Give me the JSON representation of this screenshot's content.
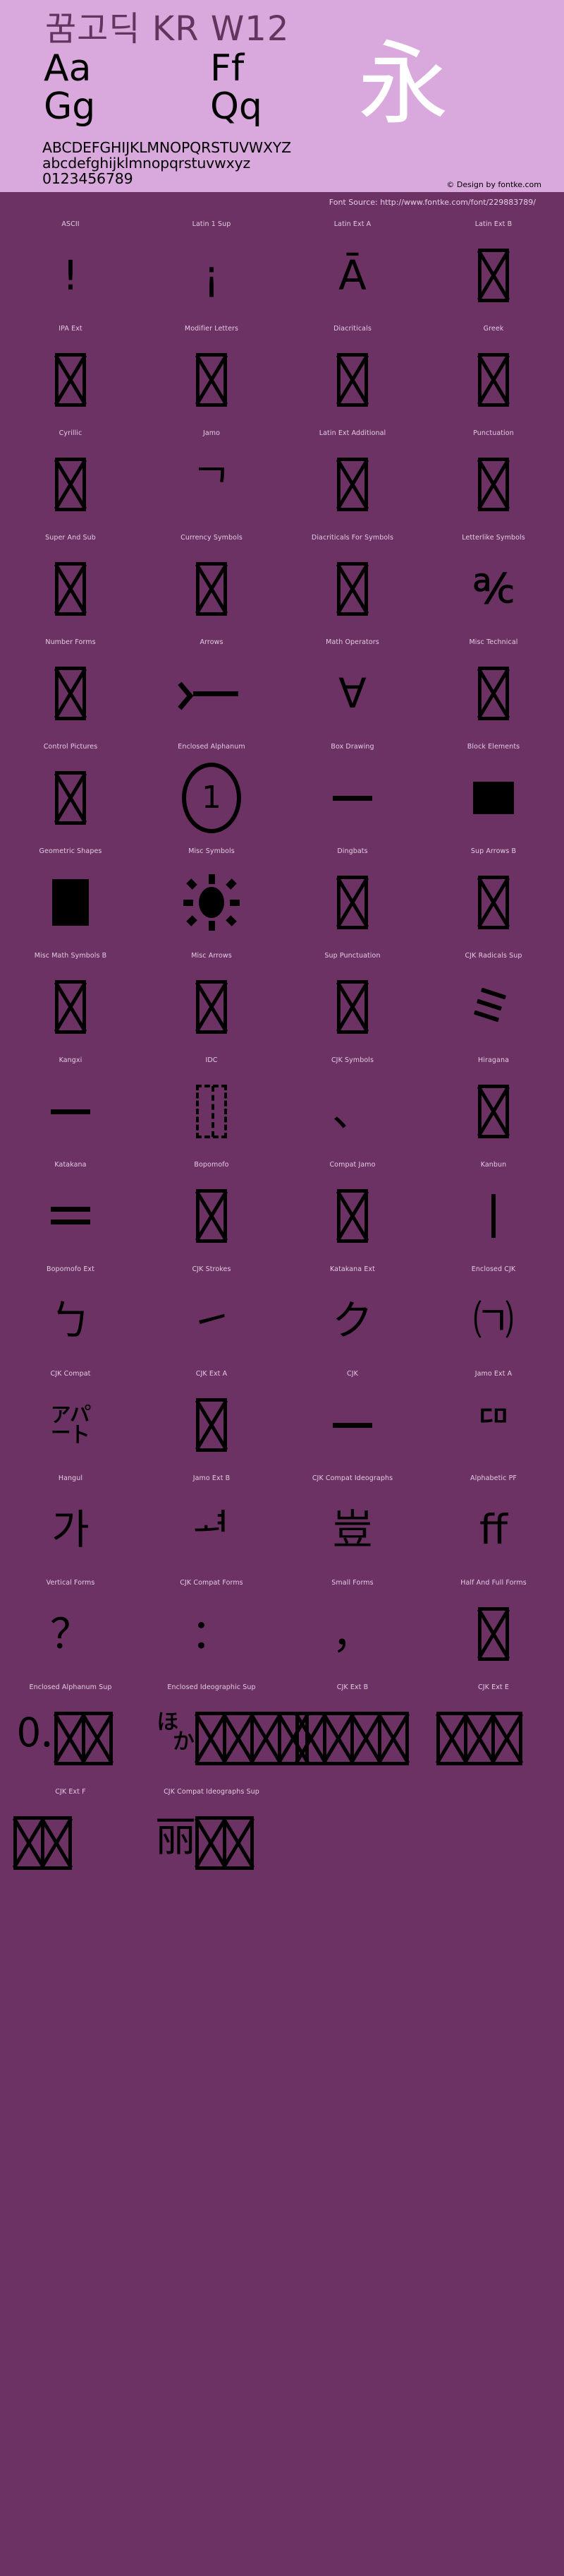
{
  "header": {
    "title": "꿈고딕 KR W12",
    "specimen_rows": [
      {
        "col1": "Aa",
        "col2": "Ff"
      },
      {
        "col1": "Gg",
        "col2": "Qq"
      }
    ],
    "cjk_specimen": "永",
    "alphabet_uppercase": "ABCDEFGHIJKLMNOPQRSTUVWXYZ",
    "alphabet_lowercase": "abcdefghijklmnopqrstuvwxyz",
    "digits": "0123456789",
    "credit": "© Design by fontke.com",
    "bg_color": "#d9a8dc",
    "title_color": "#63345e"
  },
  "source": {
    "label": "Font Source: http://www.fontke.com/font/229883789/",
    "bg_color": "#6b3263"
  },
  "grid": {
    "columns": 4,
    "label_color": "#e3cbe1",
    "glyph_color": "#000000",
    "cells": [
      {
        "label": "ASCII",
        "glyph": "!",
        "kind": "text",
        "size": "normal"
      },
      {
        "label": "Latin 1 Sup",
        "glyph": "¡",
        "kind": "text",
        "size": "normal"
      },
      {
        "label": "Latin Ext A",
        "glyph": "Ā",
        "kind": "text",
        "size": "normal"
      },
      {
        "label": "Latin Ext B",
        "glyph": "",
        "kind": "tofu",
        "size": "normal"
      },
      {
        "label": "IPA Ext",
        "glyph": "",
        "kind": "tofu",
        "size": "normal"
      },
      {
        "label": "Modifier Letters",
        "glyph": "",
        "kind": "tofu",
        "size": "normal"
      },
      {
        "label": "Diacriticals",
        "glyph": "",
        "kind": "tofu",
        "size": "normal"
      },
      {
        "label": "Greek",
        "glyph": "",
        "kind": "tofu",
        "size": "normal"
      },
      {
        "label": "Cyrillic",
        "glyph": "",
        "kind": "tofu",
        "size": "normal"
      },
      {
        "label": "Jamo",
        "glyph": "ᄀ",
        "kind": "text",
        "size": "normal"
      },
      {
        "label": "Latin Ext Additional",
        "glyph": "",
        "kind": "tofu",
        "size": "normal"
      },
      {
        "label": "Punctuation",
        "glyph": "",
        "kind": "tofu",
        "size": "normal"
      },
      {
        "label": "Super And Sub",
        "glyph": "",
        "kind": "tofu",
        "size": "normal"
      },
      {
        "label": "Currency Symbols",
        "glyph": "",
        "kind": "tofu",
        "size": "normal"
      },
      {
        "label": "Diacriticals For Symbols",
        "glyph": "",
        "kind": "tofu",
        "size": "normal"
      },
      {
        "label": "Letterlike Symbols",
        "glyph": "℀",
        "kind": "text",
        "size": "normal"
      },
      {
        "label": "Number Forms",
        "glyph": "",
        "kind": "tofu",
        "size": "normal"
      },
      {
        "label": "Arrows",
        "glyph": "←",
        "kind": "arrow",
        "size": "normal"
      },
      {
        "label": "Math Operators",
        "glyph": "∀",
        "kind": "text",
        "size": "normal"
      },
      {
        "label": "Misc Technical",
        "glyph": "",
        "kind": "tofu",
        "size": "normal"
      },
      {
        "label": "Control Pictures",
        "glyph": "",
        "kind": "tofu",
        "size": "normal"
      },
      {
        "label": "Enclosed Alphanum",
        "glyph": "1",
        "kind": "circled",
        "size": "normal"
      },
      {
        "label": "Box Drawing",
        "glyph": "─",
        "kind": "hline",
        "size": "normal"
      },
      {
        "label": "Block Elements",
        "glyph": "█",
        "kind": "block",
        "size": "normal"
      },
      {
        "label": "Geometric Shapes",
        "glyph": "■",
        "kind": "block-sq",
        "size": "normal"
      },
      {
        "label": "Misc Symbols",
        "glyph": "☀",
        "kind": "sun",
        "size": "normal"
      },
      {
        "label": "Dingbats",
        "glyph": "",
        "kind": "tofu",
        "size": "normal"
      },
      {
        "label": "Sup Arrows B",
        "glyph": "",
        "kind": "tofu",
        "size": "normal"
      },
      {
        "label": "Misc Math Symbols B",
        "glyph": "",
        "kind": "tofu",
        "size": "normal"
      },
      {
        "label": "Misc Arrows",
        "glyph": "",
        "kind": "tofu",
        "size": "normal"
      },
      {
        "label": "Sup Punctuation",
        "glyph": "",
        "kind": "tofu",
        "size": "normal"
      },
      {
        "label": "CJK Radicals Sup",
        "glyph": "⺀",
        "kind": "strokes3",
        "size": "normal"
      },
      {
        "label": "Kangxi",
        "glyph": "⼀",
        "kind": "hline",
        "size": "normal"
      },
      {
        "label": "IDC",
        "glyph": "⿰",
        "kind": "idc",
        "size": "normal"
      },
      {
        "label": "CJK Symbols",
        "glyph": "、",
        "kind": "text",
        "size": "normal"
      },
      {
        "label": "Hiragana",
        "glyph": "",
        "kind": "tofu",
        "size": "normal"
      },
      {
        "label": "Katakana",
        "glyph": "゠",
        "kind": "dblline",
        "size": "normal"
      },
      {
        "label": "Bopomofo",
        "glyph": "",
        "kind": "tofu",
        "size": "normal"
      },
      {
        "label": "Compat Jamo",
        "glyph": "",
        "kind": "tofu",
        "size": "normal"
      },
      {
        "label": "Kanbun",
        "glyph": "㆐",
        "kind": "vline",
        "size": "normal"
      },
      {
        "label": "Bopomofo Ext",
        "glyph": "ㄅ",
        "kind": "text",
        "size": "normal"
      },
      {
        "label": "CJK Strokes",
        "glyph": "㇀",
        "kind": "text",
        "size": "normal"
      },
      {
        "label": "Katakana Ext",
        "glyph": "ク",
        "kind": "text",
        "size": "normal"
      },
      {
        "label": "Enclosed CJK",
        "glyph": "㈀",
        "kind": "text",
        "size": "normal"
      },
      {
        "label": "CJK Compat",
        "glyph": "㌀",
        "kind": "text",
        "size": "normal"
      },
      {
        "label": "CJK Ext A",
        "glyph": "",
        "kind": "tofu",
        "size": "normal"
      },
      {
        "label": "CJK",
        "glyph": "一",
        "kind": "hline",
        "size": "normal"
      },
      {
        "label": "Jamo Ext A",
        "glyph": "ꥠ",
        "kind": "text",
        "size": "normal"
      },
      {
        "label": "Hangul",
        "glyph": "가",
        "kind": "text",
        "size": "normal"
      },
      {
        "label": "Jamo Ext B",
        "glyph": "ힰ",
        "kind": "text",
        "size": "normal"
      },
      {
        "label": "CJK Compat Ideographs",
        "glyph": "豈",
        "kind": "text",
        "size": "normal"
      },
      {
        "label": "Alphabetic PF",
        "glyph": "ﬀ",
        "kind": "text",
        "size": "normal"
      },
      {
        "label": "Vertical Forms",
        "glyph": "？",
        "kind": "text",
        "size": "normal"
      },
      {
        "label": "CJK Compat Forms",
        "glyph": "：",
        "kind": "text",
        "size": "normal"
      },
      {
        "label": "Small Forms",
        "glyph": "，",
        "kind": "text",
        "size": "normal"
      },
      {
        "label": "Half And Full Forms",
        "glyph": "",
        "kind": "tofu",
        "size": "normal"
      },
      {
        "label": "Enclosed Alphanum Sup",
        "glyph": "🄀",
        "kind": "wide-tofu",
        "size": "normal",
        "tofu_count": 2
      },
      {
        "label": "Enclosed Ideographic Sup",
        "glyph": "🈀",
        "kind": "wide-tofu",
        "size": "normal",
        "tofu_count": 4
      },
      {
        "label": "CJK Ext B",
        "glyph": "𠀀",
        "kind": "wide-tofu",
        "size": "normal",
        "tofu_count": 4
      },
      {
        "label": "CJK Ext E",
        "glyph": "𫝀",
        "kind": "wide-tofu",
        "size": "normal",
        "tofu_count": 3
      },
      {
        "label": "CJK Ext F",
        "glyph": "𫠠",
        "kind": "wide-tofu",
        "size": "normal",
        "tofu_count": 2
      },
      {
        "label": "CJK Compat Ideographs Sup",
        "glyph": "丽",
        "kind": "wide-tofu",
        "size": "normal",
        "tofu_count": 2
      }
    ]
  }
}
